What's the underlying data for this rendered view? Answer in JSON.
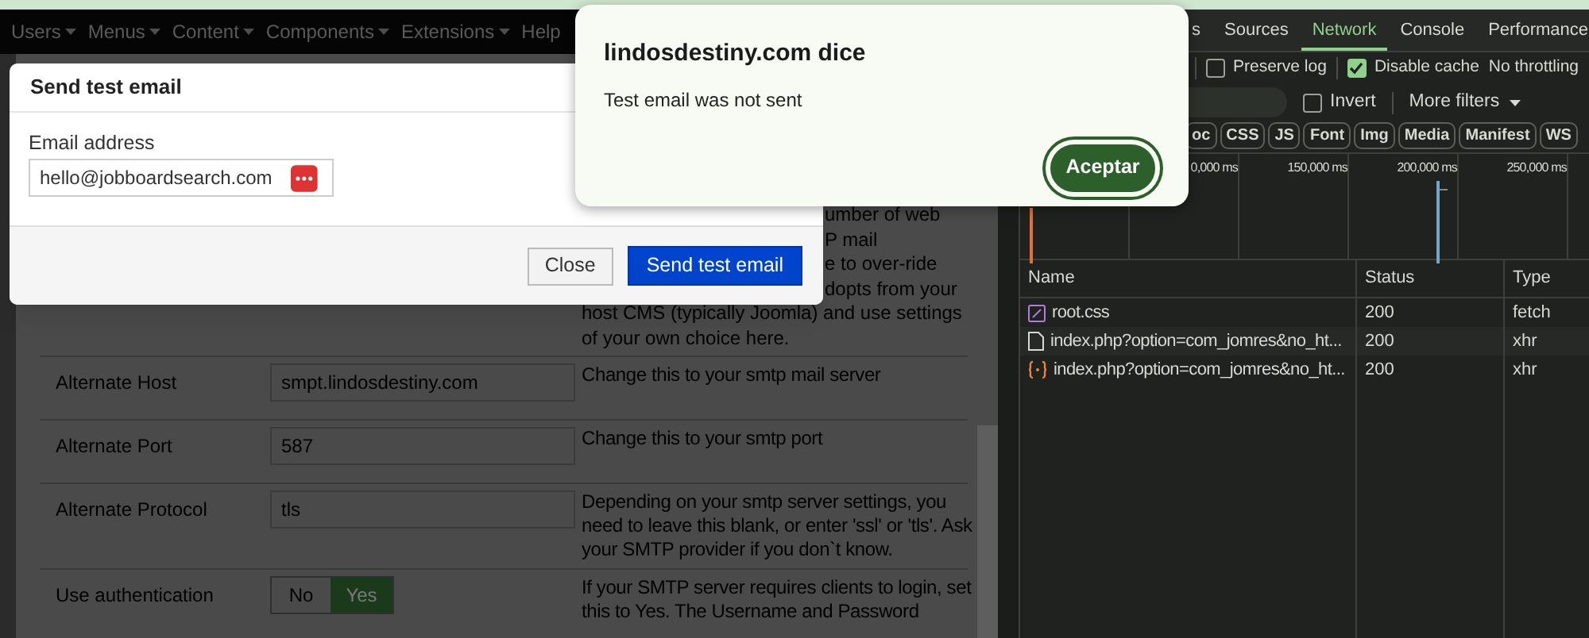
{
  "nav_menu": [
    {
      "label": "Users",
      "has_caret": true
    },
    {
      "label": "Menus",
      "has_caret": true
    },
    {
      "label": "Content",
      "has_caret": true
    },
    {
      "label": "Components",
      "has_caret": true
    },
    {
      "label": "Extensions",
      "has_caret": true
    },
    {
      "label": "Help",
      "has_caret": false
    }
  ],
  "settings": {
    "description_lines": [
      {
        "text": "umber of web",
        "covered": true
      },
      {
        "text": "P mail",
        "covered": true
      },
      {
        "text": "e to over-ride",
        "covered": true
      },
      {
        "text": "dopts from your",
        "covered": true
      },
      {
        "text": "host CMS (typically Joomla) and use settings",
        "covered": false
      },
      {
        "text": "of your own choice here.",
        "covered": false
      }
    ],
    "rows": [
      {
        "kind": "text",
        "label": "Alternate Host",
        "value": "smpt.lindosdestiny.com",
        "description": "Change this to your smtp mail server"
      },
      {
        "kind": "text",
        "label": "Alternate Port",
        "value": "587",
        "description": "Change this to your smtp port"
      },
      {
        "kind": "text",
        "label": "Alternate Protocol",
        "value": "tls",
        "description": "Depending on your smtp server settings, you need to leave this blank, or enter 'ssl' or 'tls'. Ask your SMTP provider if you don`t know."
      },
      {
        "kind": "toggle",
        "label": "Use authentication",
        "options": [
          {
            "label": "No",
            "selected": false
          },
          {
            "label": "Yes",
            "selected": true
          }
        ],
        "description": "If your SMTP server requires clients to login, set this to Yes. The Username and Password"
      }
    ]
  },
  "modal": {
    "title": "Send test email",
    "field_label": "Email address",
    "field_value": "hello@jobboardsearch.com",
    "buttons": [
      {
        "label": "Close",
        "kind": "secondary"
      },
      {
        "label": "Send test email",
        "kind": "primary"
      }
    ]
  },
  "alert": {
    "title": "lindosdestiny.com dice",
    "message": "Test email was not sent",
    "button": "Aceptar"
  },
  "devtools": {
    "tabs": [
      {
        "label": "s",
        "selected": false
      },
      {
        "label": "Sources",
        "selected": false
      },
      {
        "label": "Network",
        "selected": true
      },
      {
        "label": "Console",
        "selected": false
      },
      {
        "label": "Performance",
        "selected": false
      }
    ],
    "options": [
      {
        "label": "Preserve log",
        "checked": false
      },
      {
        "label": "Disable cache",
        "checked": true
      }
    ],
    "throttling": "No throttling",
    "invert": {
      "label": "Invert",
      "checked": false
    },
    "more_filters": "More filters",
    "type_filters": [
      "oc",
      "CSS",
      "JS",
      "Font",
      "Img",
      "Media",
      "Manifest",
      "WS"
    ],
    "timeline_ticks": [
      "0,000 ms",
      "150,000 ms",
      "200,000 ms",
      "250,000 ms"
    ],
    "table": {
      "columns": [
        "Name",
        "Status",
        "Type"
      ],
      "rows": [
        {
          "kind": "stylesheet",
          "name": "root.css",
          "status": "200",
          "type": "fetch"
        },
        {
          "kind": "document",
          "name": "index.php?option=com_jomres&no_ht...",
          "status": "200",
          "type": "xhr"
        },
        {
          "kind": "script",
          "name": "index.php?option=com_jomres&no_ht...",
          "status": "200",
          "type": "xhr"
        }
      ]
    }
  }
}
